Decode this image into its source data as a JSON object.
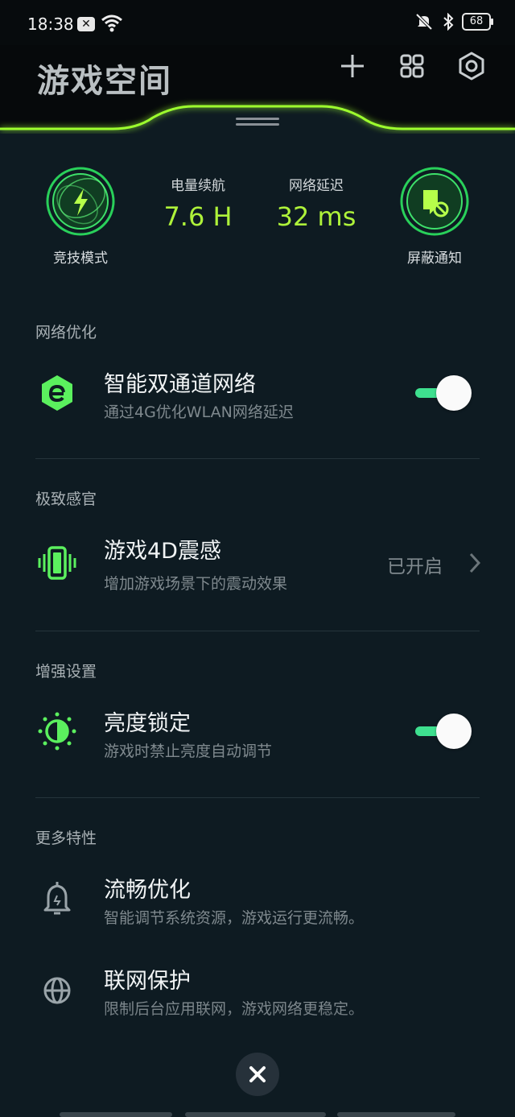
{
  "status_bar": {
    "time": "18:38",
    "notif_icon": "close-box-icon",
    "battery": "68"
  },
  "header": {
    "title": "游戏空间",
    "add_icon": "plus-icon",
    "apps_icon": "grid-icon",
    "settings_icon": "gear-icon"
  },
  "stats": {
    "left_mode": {
      "label": "竞技模式",
      "icon": "lightning-icon"
    },
    "battery_life": {
      "label": "电量续航",
      "value": "7.6 H"
    },
    "latency": {
      "label": "网络延迟",
      "value": "32 ms"
    },
    "right_mode": {
      "label": "屏蔽通知",
      "icon": "block-notification-icon"
    }
  },
  "sections": {
    "network": {
      "title": "网络优化",
      "item": {
        "title": "智能双通道网络",
        "subtitle": "通过4G优化WLAN网络延迟",
        "toggle_on": true
      }
    },
    "senses": {
      "title": "极致感官",
      "item": {
        "title": "游戏4D震感",
        "subtitle": "增加游戏场景下的震动效果",
        "value": "已开启"
      }
    },
    "enhance": {
      "title": "增强设置",
      "item": {
        "title": "亮度锁定",
        "subtitle": "游戏时禁止亮度自动调节",
        "toggle_on": true
      }
    },
    "more": {
      "title": "更多特性",
      "items": [
        {
          "title": "流畅优化",
          "subtitle": "智能调节系统资源，游戏运行更流畅。"
        },
        {
          "title": "联网保护",
          "subtitle": "限制后台应用联网，游戏网络更稳定。"
        }
      ]
    }
  },
  "colors": {
    "accent": "#aef23a",
    "toggle": "#3ee08f",
    "background": "#0e1b22"
  }
}
